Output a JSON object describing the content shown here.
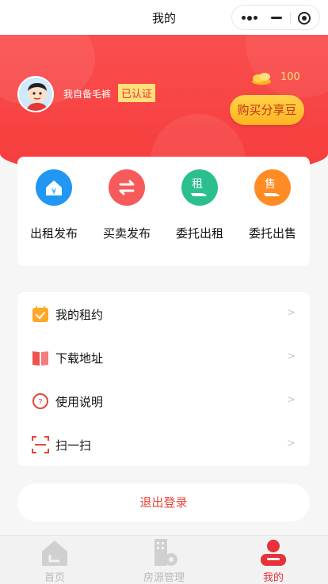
{
  "navbar": {
    "title": "我的"
  },
  "profile": {
    "nickname": "我自备毛裤",
    "verified_badge": "已认证",
    "coins": "100",
    "buy_button": "购买分享豆"
  },
  "quick_actions": [
    {
      "label": "出租发布",
      "icon": "house-yen-icon",
      "color": "#2196f3",
      "glyph": "¥"
    },
    {
      "label": "买卖发布",
      "icon": "swap-arrows-icon",
      "color": "#f65a5a",
      "glyph": "⇆"
    },
    {
      "label": "委托出租",
      "icon": "hand-rent-icon",
      "color": "#2bbf8f",
      "glyph": "租"
    },
    {
      "label": "委托出售",
      "icon": "hand-sale-icon",
      "color": "#ff8b24",
      "glyph": "售"
    }
  ],
  "menu": [
    {
      "label": "我的租约",
      "icon": "calendar-check-icon",
      "arrow": ">"
    },
    {
      "label": "下载地址",
      "icon": "book-icon",
      "arrow": ">"
    },
    {
      "label": "使用说明",
      "icon": "help-circle-icon",
      "arrow": ">"
    },
    {
      "label": "扫一扫",
      "icon": "scan-icon",
      "arrow": ">"
    }
  ],
  "logout_label": "退出登录",
  "tabs": [
    {
      "label": "首页",
      "icon": "home-icon",
      "active": false
    },
    {
      "label": "房源管理",
      "icon": "building-gear-icon",
      "active": false
    },
    {
      "label": "我的",
      "icon": "user-icon",
      "active": true
    }
  ],
  "colors": {
    "brand_red": "#f63c3c",
    "gold": "#ffb51f",
    "active_tab": "#e8313a"
  }
}
